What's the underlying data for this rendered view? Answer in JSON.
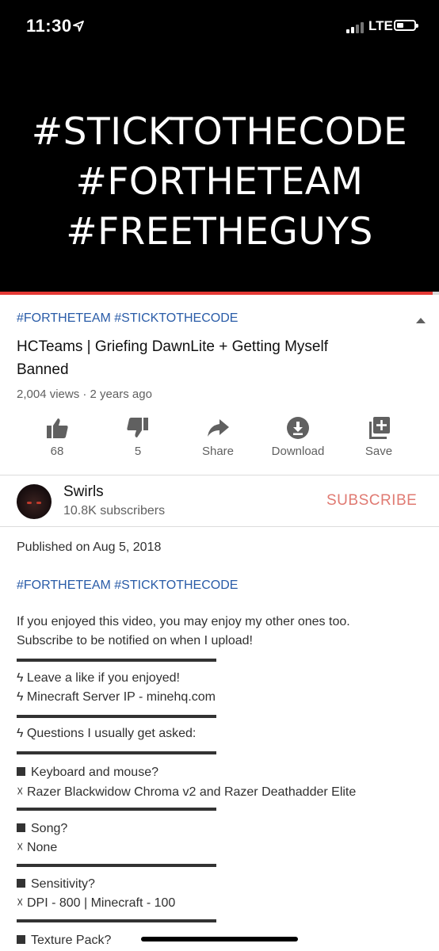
{
  "status_bar": {
    "time": "11:30",
    "network": "LTE"
  },
  "video": {
    "overlay_lines": [
      "#STICKTOTHECODE",
      "#FORTHETEAM",
      "#FREETHEGUYS"
    ],
    "progress": 0.985
  },
  "info": {
    "hashtags": "#FORTHETEAM #STICKTOTHECODE",
    "title": "HCTeams | Griefing DawnLite + Getting Myself Banned",
    "meta": "2,004 views · 2 years ago"
  },
  "actions": {
    "like": "68",
    "dislike": "5",
    "share": "Share",
    "download": "Download",
    "save": "Save"
  },
  "channel": {
    "name": "Swirls",
    "subscribers": "10.8K subscribers",
    "subscribe_label": "SUBSCRIBE"
  },
  "description": {
    "published": "Published on Aug 5, 2018",
    "hashtags": "#FORTHETEAM #STICKTOTHECODE",
    "intro_1": "If you enjoyed this video, you may enjoy my other ones too.",
    "intro_2": "Subscribe to be notified on when I upload!",
    "like_line": "ϟ Leave a like if you enjoyed!",
    "server_line": "ϟ Minecraft Server IP - minehq.com",
    "questions_line": "ϟ Questions I usually get asked:",
    "q1": "Keyboard and mouse?",
    "a1": "☓ Razer Blackwidow Chroma v2 and Razer Deathadder Elite",
    "q2": "Song?",
    "a2": "☓ None",
    "q3": "Sensitivity?",
    "a3": "☓ DPI - 800 | Minecraft - 100",
    "q4": "Texture Pack?"
  },
  "colors": {
    "link": "#2a5ca8",
    "subscribe": "#e07a72",
    "progress": "#e53935"
  }
}
